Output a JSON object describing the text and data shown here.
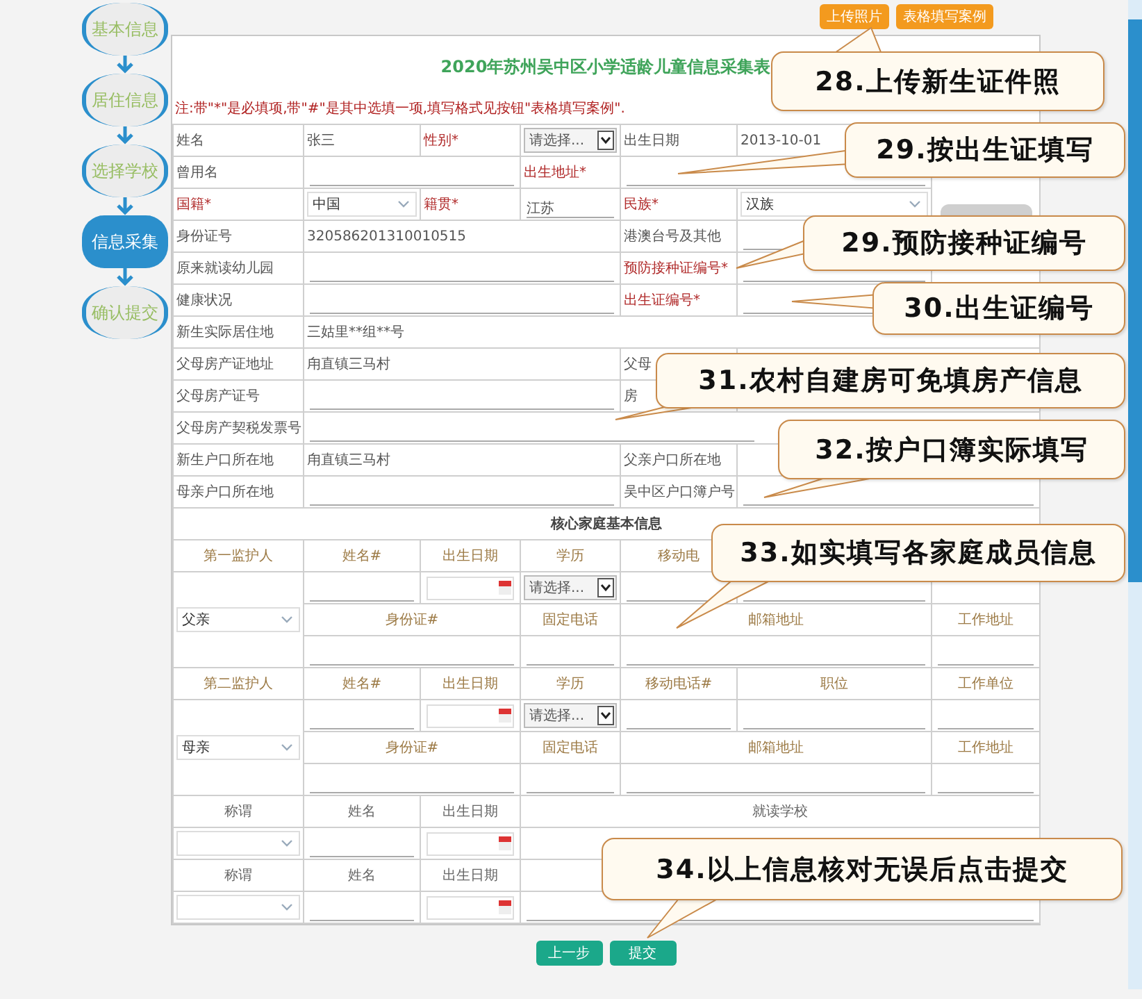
{
  "steps": [
    {
      "label": "基本信息",
      "selected": false
    },
    {
      "label": "居住信息",
      "selected": false
    },
    {
      "label": "选择学校",
      "selected": false
    },
    {
      "label": "信息采集",
      "selected": true
    },
    {
      "label": "确认提交",
      "selected": false
    }
  ],
  "top_buttons": [
    "上传照片",
    "表格填写案例"
  ],
  "form": {
    "title": "2020年苏州吴中区小学适龄儿童信息采集表",
    "note": "注:带\"*\"是必填项,带\"#\"是其中选填一项,填写格式见按钮\"表格填写案例\".",
    "rows": [
      [
        {
          "kind": "label",
          "text": "姓名",
          "required": false
        },
        {
          "kind": "text",
          "text": "张三"
        },
        {
          "kind": "label",
          "text": "性别*",
          "required": true
        },
        {
          "kind": "select",
          "value": "请选择..."
        },
        {
          "kind": "label",
          "text": "出生日期",
          "required": false
        },
        {
          "kind": "text",
          "text": "2013-10-01"
        },
        {
          "kind": "photo",
          "rowspan": 6
        }
      ],
      [
        {
          "kind": "label",
          "text": "曾用名",
          "required": false
        },
        {
          "kind": "input",
          "colspan": 2
        },
        {
          "kind": "label",
          "text": "出生地址*",
          "required": true
        },
        {
          "kind": "input",
          "colspan": 2
        }
      ],
      [
        {
          "kind": "label",
          "text": "国籍*",
          "required": true
        },
        {
          "kind": "combo",
          "value": "中国"
        },
        {
          "kind": "label",
          "text": "籍贯*",
          "required": true
        },
        {
          "kind": "input",
          "value": "江苏"
        },
        {
          "kind": "label",
          "text": "民族*",
          "required": true
        },
        {
          "kind": "combo",
          "value": "汉族"
        }
      ],
      [
        {
          "kind": "label",
          "text": "身份证号",
          "required": false
        },
        {
          "kind": "text",
          "text": "320586201310010515",
          "colspan": 3
        },
        {
          "kind": "label",
          "text": "港澳台号及其他",
          "required": false
        },
        {
          "kind": "input"
        }
      ],
      [
        {
          "kind": "label",
          "text": "原来就读幼儿园",
          "required": false
        },
        {
          "kind": "input",
          "colspan": 3
        },
        {
          "kind": "label",
          "text": "预防接种证编号*",
          "required": true
        },
        {
          "kind": "input"
        }
      ],
      [
        {
          "kind": "label",
          "text": "健康状况",
          "required": false
        },
        {
          "kind": "input",
          "colspan": 3
        },
        {
          "kind": "label",
          "text": "出生证编号*",
          "required": true
        },
        {
          "kind": "input"
        }
      ],
      [
        {
          "kind": "label",
          "text": "新生实际居住地",
          "required": false
        },
        {
          "kind": "text",
          "text": "三姑里**组**号",
          "colspan": 6
        }
      ],
      [
        {
          "kind": "label",
          "text": "父母房产证地址",
          "required": false
        },
        {
          "kind": "text",
          "text": "甪直镇三马村",
          "colspan": 3
        },
        {
          "kind": "label",
          "text": "父母",
          "required": false
        },
        {
          "kind": "blank",
          "colspan": 2
        }
      ],
      [
        {
          "kind": "label",
          "text": "父母房产证号",
          "required": false
        },
        {
          "kind": "input",
          "colspan": 3
        },
        {
          "kind": "label",
          "text": "房",
          "required": false
        },
        {
          "kind": "blank",
          "colspan": 2
        }
      ],
      [
        {
          "kind": "label",
          "text": "父母房产契税发票号",
          "required": false
        },
        {
          "kind": "input",
          "colspan": 6
        }
      ],
      [
        {
          "kind": "label",
          "text": "新生户口所在地",
          "required": false
        },
        {
          "kind": "text",
          "text": "甪直镇三马村",
          "colspan": 3
        },
        {
          "kind": "label",
          "text": "父亲户口所在地",
          "required": false
        },
        {
          "kind": "blank",
          "colspan": 2
        }
      ],
      [
        {
          "kind": "label",
          "text": "母亲户口所在地",
          "required": false
        },
        {
          "kind": "input",
          "colspan": 3
        },
        {
          "kind": "label",
          "text": "吴中区户口簿户号",
          "required": false
        },
        {
          "kind": "input",
          "colspan": 2
        }
      ],
      [
        {
          "kind": "section",
          "text": "核心家庭基本信息",
          "colspan": 7
        }
      ],
      [
        {
          "kind": "head",
          "text": "第一监护人"
        },
        {
          "kind": "head",
          "text": "姓名#"
        },
        {
          "kind": "head",
          "text": "出生日期"
        },
        {
          "kind": "head",
          "text": "学历"
        },
        {
          "kind": "head",
          "text": "移动电"
        },
        {
          "kind": "blank"
        },
        {
          "kind": "blank"
        }
      ],
      [
        {
          "kind": "combo",
          "value": "父亲",
          "rowspan": 3
        },
        {
          "kind": "input"
        },
        {
          "kind": "date"
        },
        {
          "kind": "select",
          "value": "请选择..."
        },
        {
          "kind": "input"
        },
        {
          "kind": "input"
        },
        {
          "kind": "blank"
        }
      ],
      [
        {
          "kind": "head",
          "text": "身份证#",
          "colspan": 2
        },
        {
          "kind": "head",
          "text": "固定电话"
        },
        {
          "kind": "head",
          "text": "邮箱地址",
          "colspan": 2
        },
        {
          "kind": "head",
          "text": "工作地址"
        }
      ],
      [
        {
          "kind": "input",
          "colspan": 2
        },
        {
          "kind": "input"
        },
        {
          "kind": "input",
          "colspan": 2
        },
        {
          "kind": "input"
        }
      ],
      [
        {
          "kind": "head",
          "text": "第二监护人"
        },
        {
          "kind": "head",
          "text": "姓名#"
        },
        {
          "kind": "head",
          "text": "出生日期"
        },
        {
          "kind": "head",
          "text": "学历"
        },
        {
          "kind": "head",
          "text": "移动电话#"
        },
        {
          "kind": "head",
          "text": "职位"
        },
        {
          "kind": "head",
          "text": "工作单位"
        }
      ],
      [
        {
          "kind": "combo",
          "value": "母亲",
          "rowspan": 3
        },
        {
          "kind": "input"
        },
        {
          "kind": "date"
        },
        {
          "kind": "select",
          "value": "请选择..."
        },
        {
          "kind": "input"
        },
        {
          "kind": "input"
        },
        {
          "kind": "input"
        }
      ],
      [
        {
          "kind": "head",
          "text": "身份证#",
          "colspan": 2
        },
        {
          "kind": "head",
          "text": "固定电话"
        },
        {
          "kind": "head",
          "text": "邮箱地址",
          "colspan": 2
        },
        {
          "kind": "head",
          "text": "工作地址"
        }
      ],
      [
        {
          "kind": "input",
          "colspan": 2
        },
        {
          "kind": "input"
        },
        {
          "kind": "input",
          "colspan": 2
        },
        {
          "kind": "input"
        }
      ],
      [
        {
          "kind": "caption",
          "text": "称谓"
        },
        {
          "kind": "caption",
          "text": "姓名"
        },
        {
          "kind": "caption",
          "text": "出生日期"
        },
        {
          "kind": "caption",
          "text": "就读学校",
          "colspan": 4
        }
      ],
      [
        {
          "kind": "combo"
        },
        {
          "kind": "input"
        },
        {
          "kind": "date"
        },
        {
          "kind": "blank",
          "colspan": 4
        }
      ],
      [
        {
          "kind": "caption",
          "text": "称谓"
        },
        {
          "kind": "caption",
          "text": "姓名"
        },
        {
          "kind": "caption",
          "text": "出生日期"
        },
        {
          "kind": "blank",
          "colspan": 4
        }
      ],
      [
        {
          "kind": "combo"
        },
        {
          "kind": "input"
        },
        {
          "kind": "date"
        },
        {
          "kind": "input",
          "colspan": 4
        }
      ]
    ]
  },
  "footer_buttons": [
    "上一步",
    "提交"
  ],
  "callouts": [
    "28.上传新生证件照",
    "29.按出生证填写",
    "29.预防接种证编号",
    "30.出生证编号",
    "31.农村自建房可免填房产信息",
    "32.按户口簿实际填写",
    "33.如实填写各家庭成员信息",
    "34.以上信息核对无误后点击提交"
  ]
}
